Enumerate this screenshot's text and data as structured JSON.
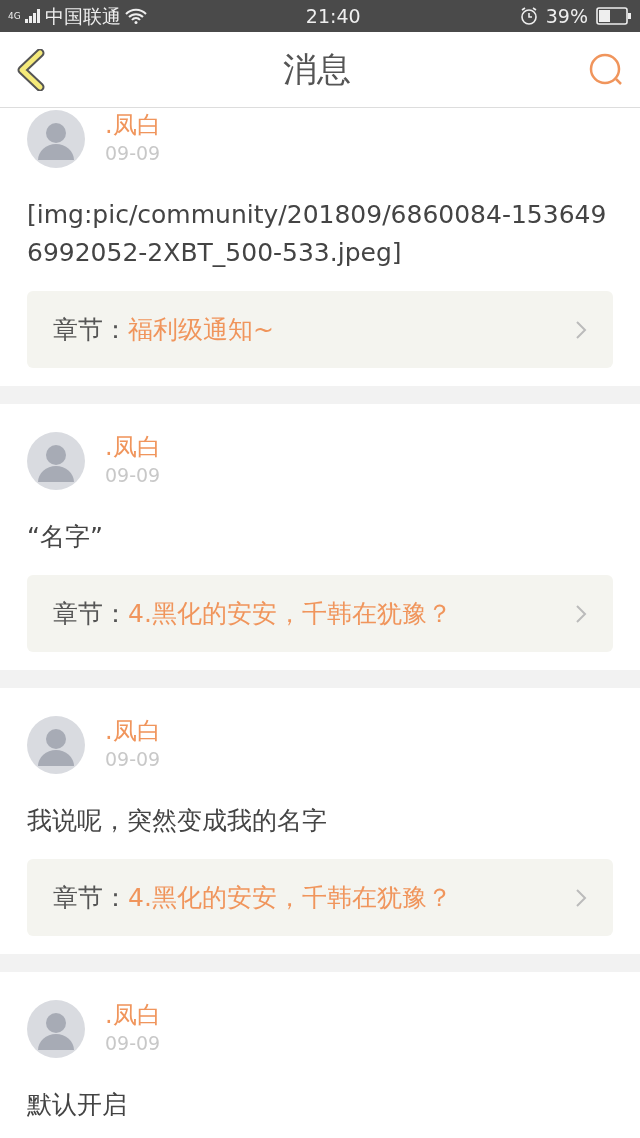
{
  "status_bar": {
    "network": "4G",
    "carrier": "中国联通",
    "time": "21:40",
    "battery": "39%"
  },
  "header": {
    "title": "消息"
  },
  "messages": [
    {
      "name": ".凤白",
      "date": "09-09",
      "text": "[img:pic/community/201809/6860084-1536496992052-2XBT_500-533.jpeg]",
      "chapter_label": "章节：",
      "chapter_title": "福利级通知~"
    },
    {
      "name": ".凤白",
      "date": "09-09",
      "text": "“名字”",
      "chapter_label": "章节：",
      "chapter_title": "4.黑化的安安，千韩在犹豫？"
    },
    {
      "name": ".凤白",
      "date": "09-09",
      "text": "我说呢，突然变成我的名字",
      "chapter_label": "章节：",
      "chapter_title": "4.黑化的安安，千韩在犹豫？"
    },
    {
      "name": ".凤白",
      "date": "09-09",
      "text": "默认开启"
    }
  ]
}
